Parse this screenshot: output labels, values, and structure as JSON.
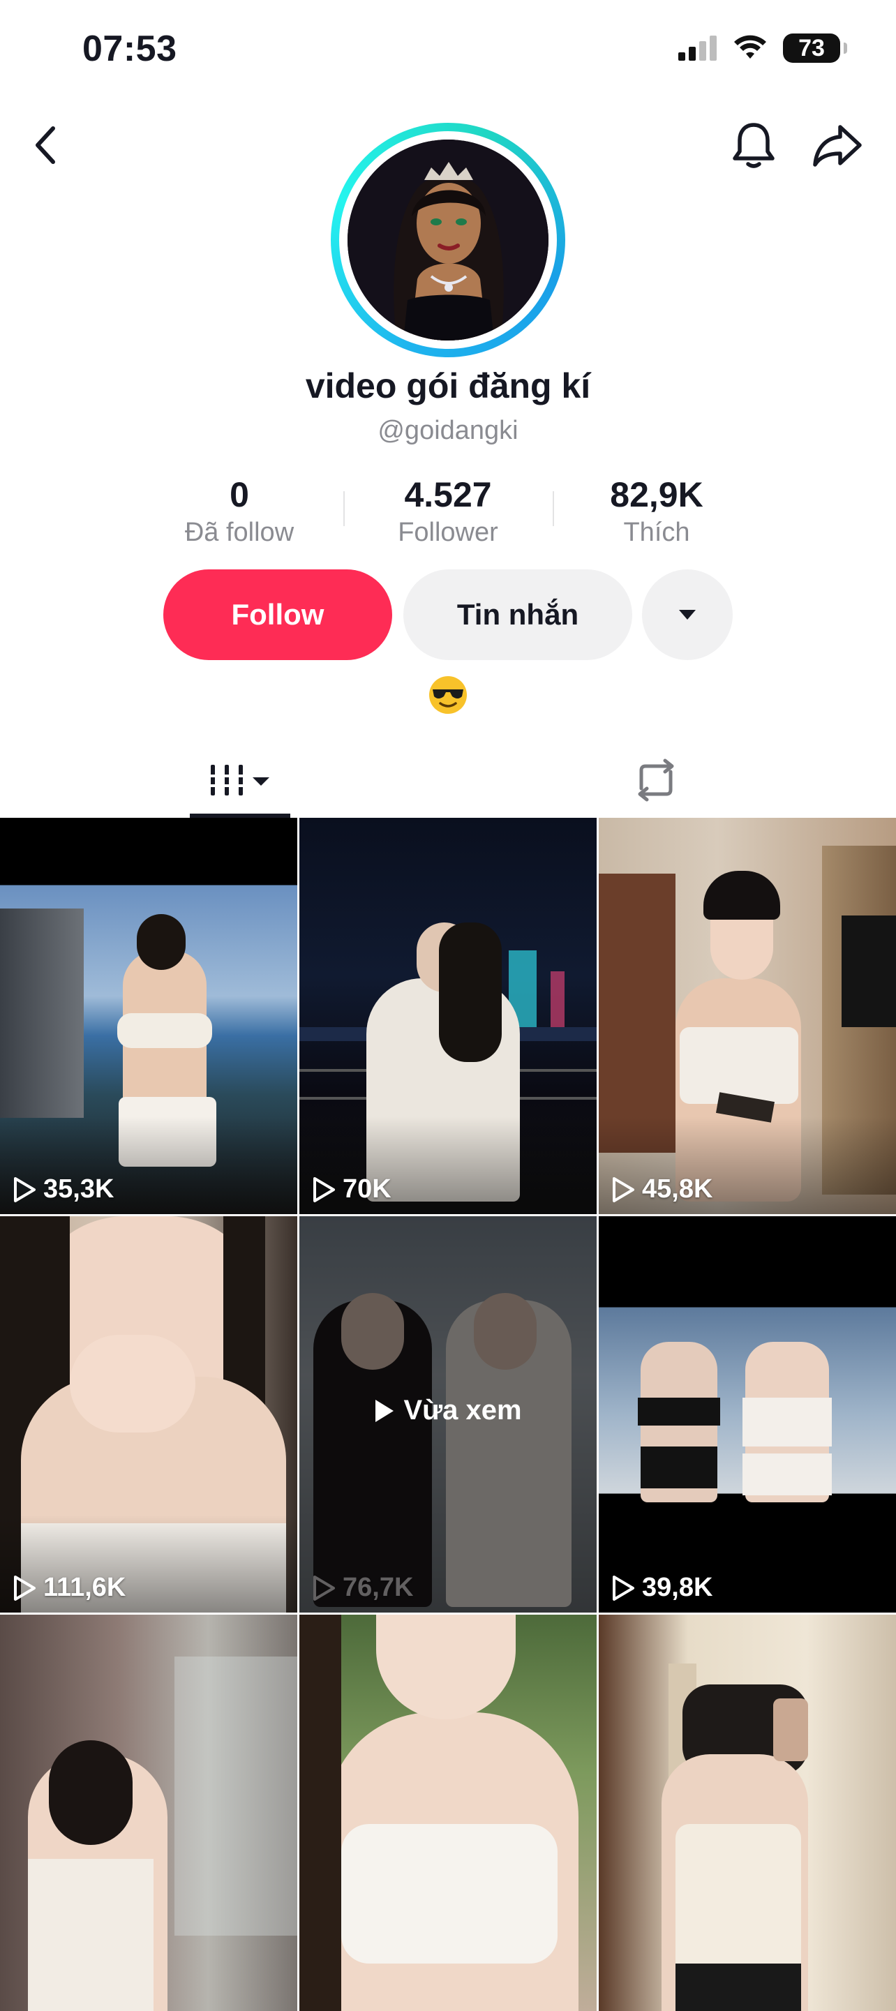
{
  "status_bar": {
    "time": "07:53",
    "battery": "73"
  },
  "profile": {
    "display_name": "video gói đăng kí",
    "username": "@goidangki",
    "bio_emoji": "😎"
  },
  "stats": [
    {
      "value": "0",
      "label": "Đã follow"
    },
    {
      "value": "4.527",
      "label": "Follower"
    },
    {
      "value": "82,9K",
      "label": "Thích"
    }
  ],
  "actions": {
    "follow": "Follow",
    "message": "Tin nhắn"
  },
  "videos": [
    {
      "views": "35,3K"
    },
    {
      "views": "70K"
    },
    {
      "views": "45,8K"
    },
    {
      "views": "111,6K"
    },
    {
      "views": "76,7K",
      "overlay": "Vừa xem"
    },
    {
      "views": "39,8K"
    },
    {
      "views": ""
    },
    {
      "views": ""
    },
    {
      "views": ""
    }
  ],
  "colors": {
    "accent": "#fe2c55",
    "ring": "#25f4ee"
  }
}
